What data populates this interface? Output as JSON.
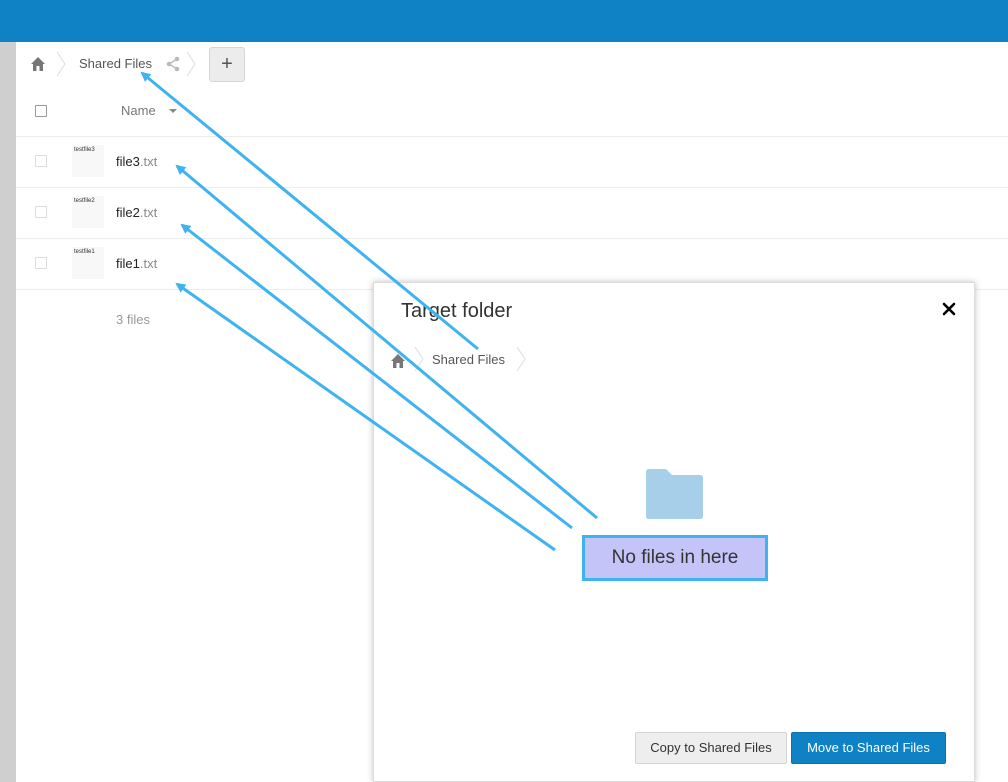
{
  "breadcrumb": {
    "home_icon": "home-icon",
    "current_folder": "Shared Files",
    "share_icon": "share-icon",
    "add_button": "+"
  },
  "file_list": {
    "header": {
      "name_label": "Name",
      "sort_icon": "caret-down-icon"
    },
    "files": [
      {
        "thumb_text": "testfile3",
        "base": "file3",
        "ext": ".txt"
      },
      {
        "thumb_text": "testfile2",
        "base": "file2",
        "ext": ".txt"
      },
      {
        "thumb_text": "testfile1",
        "base": "file1",
        "ext": ".txt"
      }
    ],
    "summary": "3 files"
  },
  "dialog": {
    "title": "Target folder",
    "close_icon": "close-icon",
    "breadcrumb": {
      "home_icon": "home-icon",
      "current_folder": "Shared Files"
    },
    "folder_icon": "folder-icon",
    "empty_message": "No files in here",
    "copy_button": "Copy to Shared Files",
    "move_button": "Move to Shared Files"
  },
  "colors": {
    "topbar": "#0f82c6",
    "primary_button": "#0f82c6",
    "annotation_arrow": "#3fb3f0",
    "highlight_fill": "#c4c4f8",
    "folder": "#a8cfe9"
  }
}
